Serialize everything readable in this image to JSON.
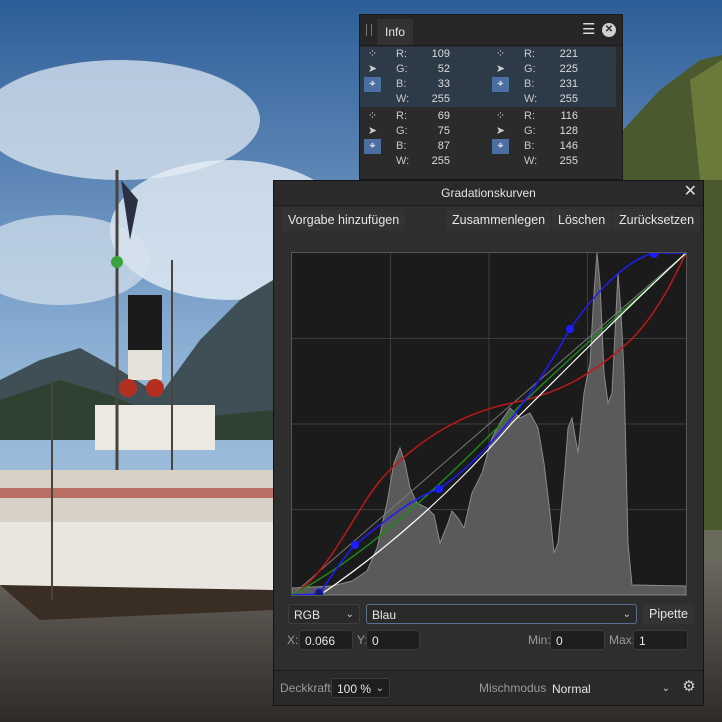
{
  "info": {
    "tab_label": "Info",
    "blocks": [
      {
        "rows": [
          {
            "icon": "sampler-icon",
            "label": "R:",
            "value": "109"
          },
          {
            "icon": "pointer-icon",
            "label": "G:",
            "value": "52"
          },
          {
            "icon": "target-icon",
            "label": "B:",
            "value": "33"
          },
          {
            "icon": "",
            "label": "W:",
            "value": "255"
          }
        ]
      },
      {
        "rows": [
          {
            "icon": "sampler-icon",
            "label": "R:",
            "value": "221"
          },
          {
            "icon": "pointer-icon",
            "label": "G:",
            "value": "225"
          },
          {
            "icon": "target-icon",
            "label": "B:",
            "value": "231"
          },
          {
            "icon": "",
            "label": "W:",
            "value": "255"
          }
        ]
      },
      {
        "rows": [
          {
            "icon": "sampler-icon",
            "label": "R:",
            "value": "69"
          },
          {
            "icon": "pointer-icon",
            "label": "G:",
            "value": "75"
          },
          {
            "icon": "target-icon",
            "label": "B:",
            "value": "87"
          },
          {
            "icon": "",
            "label": "W:",
            "value": "255"
          }
        ]
      },
      {
        "rows": [
          {
            "icon": "sampler-icon",
            "label": "R:",
            "value": "116"
          },
          {
            "icon": "pointer-icon",
            "label": "G:",
            "value": "128"
          },
          {
            "icon": "target-icon",
            "label": "B:",
            "value": "146"
          },
          {
            "icon": "",
            "label": "W:",
            "value": "255"
          }
        ]
      }
    ]
  },
  "curves": {
    "title": "Gradationskurven",
    "toolbar": {
      "add_preset": "Vorgabe hinzufügen",
      "merge": "Zusammenlegen",
      "delete": "Löschen",
      "reset": "Zurücksetzen"
    },
    "channel_mode": "RGB",
    "channel": "Blau",
    "pipette": "Pipette",
    "x_label": "X:",
    "x_value": "0.066",
    "y_label": "Y:",
    "y_value": "0",
    "min_label": "Min:",
    "min_value": "0",
    "max_label": "Max:",
    "max_value": "1",
    "opacity_label": "Deckkraft:",
    "opacity_value": "100 %",
    "blend_label": "Mischmodus:",
    "blend_value": "Normal",
    "colors": {
      "red": "#c01818",
      "green": "#1a8a1a",
      "blue": "#1c1cff",
      "white": "#ffffff",
      "histogram": "#777777"
    }
  }
}
